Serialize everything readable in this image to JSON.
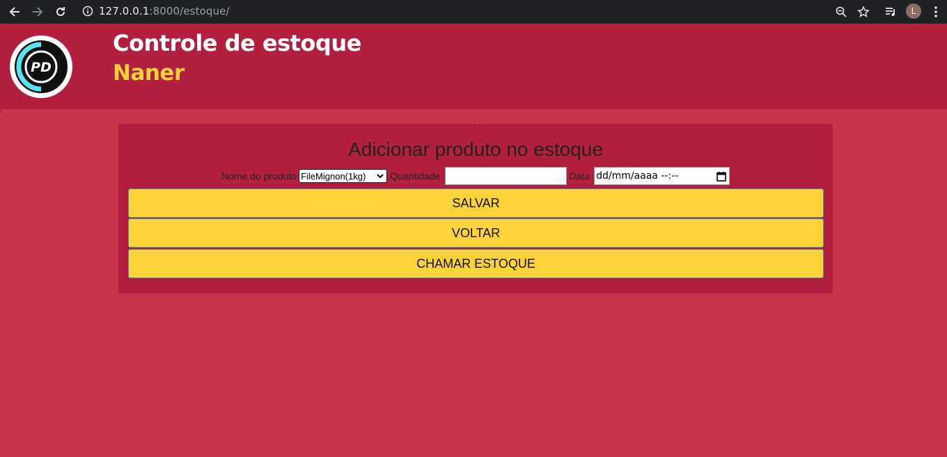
{
  "browser": {
    "url_host": "127.0.0.1",
    "url_path": ":8000/estoque/",
    "profile_initial": "L"
  },
  "header": {
    "logo_text": "PD",
    "title": "Controle de estoque",
    "subtitle": "Naner"
  },
  "form": {
    "heading": "Adicionar produto no estoque",
    "product_label": "Nome do produto",
    "product_selected": "FileMignon(1kg)",
    "quantity_label": "Quantidade",
    "quantity_value": "",
    "date_label": "Data",
    "date_placeholder": "dd/mm/aaaa --:--"
  },
  "buttons": {
    "save": "SALVAR",
    "back": "VOLTAR",
    "stock": "CHAMAR ESTOQUE"
  },
  "colors": {
    "page_bg": "#c7344b",
    "header_bg": "#b31f3e",
    "panel_bg": "#b31f3e",
    "button_bg": "#fcd23a",
    "subtitle": "#fcd23a"
  }
}
